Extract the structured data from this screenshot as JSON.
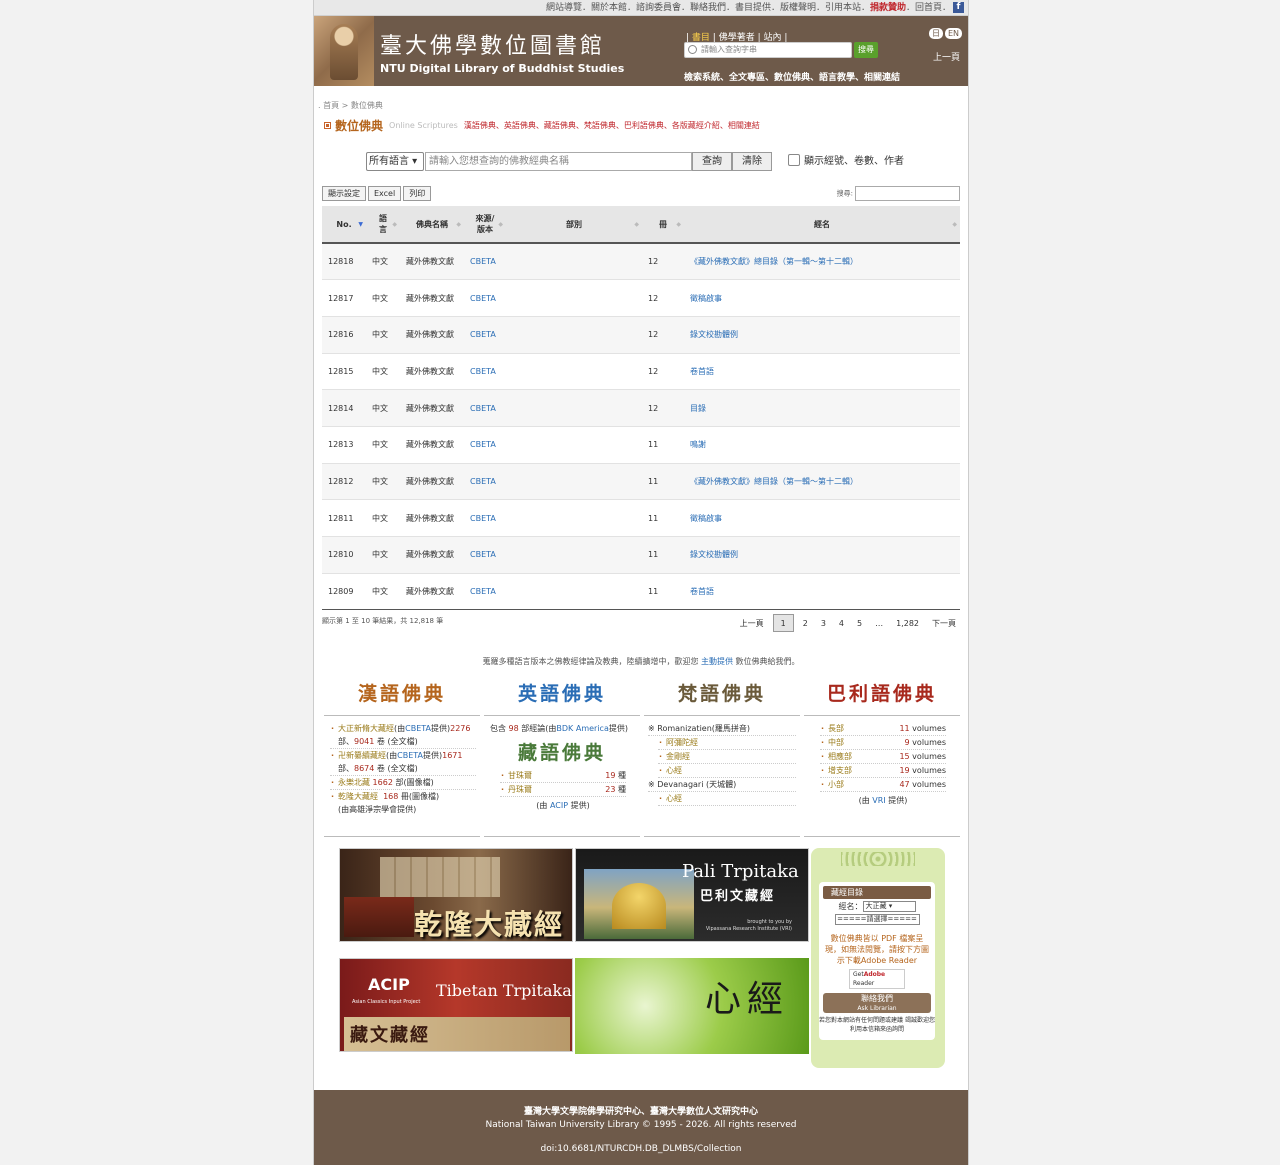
{
  "topbar": {
    "links": "網站導覽．關於本館．諮詢委員會．聯絡我們．書目提供．版權聲明．引用本站．",
    "donate": "捐款贊助",
    "tail": "．回首頁．"
  },
  "header": {
    "title": "臺大佛學數位圖書館",
    "subtitle": "NTU Digital Library of Buddhist Studies",
    "tab_books": "書目",
    "tab_authors": "佛學著者",
    "tab_site": "站內",
    "search_placeholder": "請輸入查詢字串",
    "search_button": "搜尋",
    "links": "檢索系統、全文專區、數位佛典、語言教學、相關連結",
    "lang_ja": "日",
    "lang_en": "EN",
    "prev_page": "上一頁"
  },
  "breadcrumb": {
    "home": "首頁",
    "sep": " > ",
    "current": "數位佛典"
  },
  "section": {
    "title": "數位佛典",
    "subtitle": "Online Scriptures",
    "navlinks": "漢語佛典、英語佛典、藏語佛典、梵語佛典、巴利語佛典、各版藏經介紹、相關連結"
  },
  "query": {
    "language": "所有語言",
    "placeholder": "請輸入您想查詢的佛教經典名稱",
    "search": "查詢",
    "clear": "清除",
    "checkbox_label": "顯示經號、卷數、作者"
  },
  "toolbar": {
    "display": "顯示設定",
    "excel": "Excel",
    "print": "列印",
    "filter_label": "搜尋:"
  },
  "table": {
    "headers": {
      "no": "No.",
      "lang": "語言",
      "name": "佛典名稱",
      "source": "來源/版本",
      "part": "部別",
      "vol": "冊",
      "title": "經名"
    },
    "rows": [
      {
        "no": "12818",
        "lang": "中文",
        "name": "藏外佛教文獻",
        "source": "CBETA",
        "part": "",
        "vol": "12",
        "title": "《藏外佛教文獻》總目錄（第一輯～第十二輯）"
      },
      {
        "no": "12817",
        "lang": "中文",
        "name": "藏外佛教文獻",
        "source": "CBETA",
        "part": "",
        "vol": "12",
        "title": "徵稿啟事"
      },
      {
        "no": "12816",
        "lang": "中文",
        "name": "藏外佛教文獻",
        "source": "CBETA",
        "part": "",
        "vol": "12",
        "title": "錄文校勘體例"
      },
      {
        "no": "12815",
        "lang": "中文",
        "name": "藏外佛教文獻",
        "source": "CBETA",
        "part": "",
        "vol": "12",
        "title": "卷首語"
      },
      {
        "no": "12814",
        "lang": "中文",
        "name": "藏外佛教文獻",
        "source": "CBETA",
        "part": "",
        "vol": "12",
        "title": "目錄"
      },
      {
        "no": "12813",
        "lang": "中文",
        "name": "藏外佛教文獻",
        "source": "CBETA",
        "part": "",
        "vol": "11",
        "title": "鳴謝"
      },
      {
        "no": "12812",
        "lang": "中文",
        "name": "藏外佛教文獻",
        "source": "CBETA",
        "part": "",
        "vol": "11",
        "title": "《藏外佛教文獻》總目錄（第一輯～第十二輯）"
      },
      {
        "no": "12811",
        "lang": "中文",
        "name": "藏外佛教文獻",
        "source": "CBETA",
        "part": "",
        "vol": "11",
        "title": "徵稿啟事"
      },
      {
        "no": "12810",
        "lang": "中文",
        "name": "藏外佛教文獻",
        "source": "CBETA",
        "part": "",
        "vol": "11",
        "title": "錄文校勘體例"
      },
      {
        "no": "12809",
        "lang": "中文",
        "name": "藏外佛教文獻",
        "source": "CBETA",
        "part": "",
        "vol": "11",
        "title": "卷首語"
      }
    ],
    "info": "顯示第 1 至 10 筆結果，共 12,818 筆"
  },
  "pager": {
    "prev": "上一頁",
    "pages": [
      "1",
      "2",
      "3",
      "4",
      "5",
      "…",
      "1,282"
    ],
    "next": "下一頁"
  },
  "notice": {
    "before": "蒐羅多種語言版本之佛教經律論及教典，陸續擴增中，歡迎您",
    "link": "主動提供",
    "after": "數位佛典給我們。"
  },
  "columns": {
    "chinese": {
      "title": "漢語佛典",
      "taisho_a": "大正新脩大藏經",
      "taisho_b": "(由",
      "taisho_cbeta": "CBETA",
      "taisho_c": "提供)",
      "taisho_n1": "2276",
      "taisho_d": " 部、",
      "taisho_n2": "9041",
      "taisho_e": " 卷 (全文檔)",
      "xuzang_a": "卍新纂續藏經",
      "xuzang_b": "(由",
      "xuzang_cbeta": "CBETA",
      "xuzang_c": "提供)",
      "xuzang_n1": "1671",
      "xuzang_d": " 部、",
      "xuzang_n2": "8674",
      "xuzang_e": " 卷 (全文檔)",
      "yongle_a": "永樂北藏",
      "yongle_n": "1662",
      "yongle_b": " 部(圖像檔)",
      "qianlong_a": "乾隆大藏經",
      "qianlong_n": "168",
      "qianlong_b": " 冊(圖像檔)",
      "qianlong_c": "(由高雄淨宗學會提供)"
    },
    "english": {
      "title": "英語佛典",
      "desc_a": "包含 ",
      "desc_n": "98",
      "desc_b": " 部經論(由",
      "desc_link": "BDK America",
      "desc_c": "提供)",
      "tibetan_title": "藏語佛典",
      "kangyur": "甘珠爾",
      "kangyur_n": "19",
      "kangyur_u": " 種",
      "tengyur": "丹珠爾",
      "tengyur_n": "23",
      "tengyur_u": " 種",
      "by_a": "(由 ",
      "by_link": "ACIP",
      "by_b": " 提供)"
    },
    "sanskrit": {
      "title": "梵語佛典",
      "roman": "※ Romanizatien(羅馬拼音)",
      "r1": "阿彌陀經",
      "r2": "金剛經",
      "r3": "心經",
      "deva": "※ Devanagari (天城體)",
      "d1": "心經"
    },
    "pali": {
      "title": "巴利語佛典",
      "items": [
        {
          "name": "長部",
          "n": "11",
          "u": " volumes"
        },
        {
          "name": "中部",
          "n": "9",
          "u": " volumes"
        },
        {
          "name": "相應部",
          "n": "15",
          "u": " volumes"
        },
        {
          "name": "增支部",
          "n": "19",
          "u": " volumes"
        },
        {
          "name": "小部",
          "n": "47",
          "u": " volumes"
        }
      ],
      "by_a": "(由 ",
      "by_link": "VRI",
      "by_b": " 提供)"
    }
  },
  "banners": {
    "qianlong": "乾隆大藏經",
    "pali_title": "Pali Trpitaka",
    "pali_sub": "巴利文藏經",
    "pali_credit1": "brought to you by",
    "pali_credit2": "Vipassana Research Institute (VRI)",
    "acip_logo": "ACIP",
    "acip_sub": "Asian Classics Input Project",
    "acip_title": "Tibetan Trpitaka",
    "acip_cn": "藏文藏經",
    "heart": "心經"
  },
  "side": {
    "header": "藏經目錄",
    "label": "經名：",
    "canon": "大正藏",
    "choose": "=====請選擇=====",
    "pdf": "數位佛典皆以 PDF 檔案呈現，如無法閱覽，請按下方圖示下載Adobe Reader",
    "adobe_get": "Get",
    "adobe_name": "Adobe",
    "adobe_reader": "Reader",
    "contact": "聯絡我們",
    "contact_en": "Ask Librarian",
    "note": "若您對本網站有任何問題或建議 竭誠歡迎您利用本信箱來函詢問"
  },
  "footer": {
    "line1": "臺灣大學文學院佛學研究中心、臺灣大學數位人文研究中心",
    "line2": "National Taiwan University Library © 1995 - 2026. All rights reserved",
    "doi": "doi:10.6681/NTURCDH.DB_DLMBS/Collection"
  },
  "colors": {
    "header_bg": "#6e5a4a",
    "accent": "#b5651d",
    "link": "#2a6db5",
    "search_green": "#5aa02c"
  }
}
